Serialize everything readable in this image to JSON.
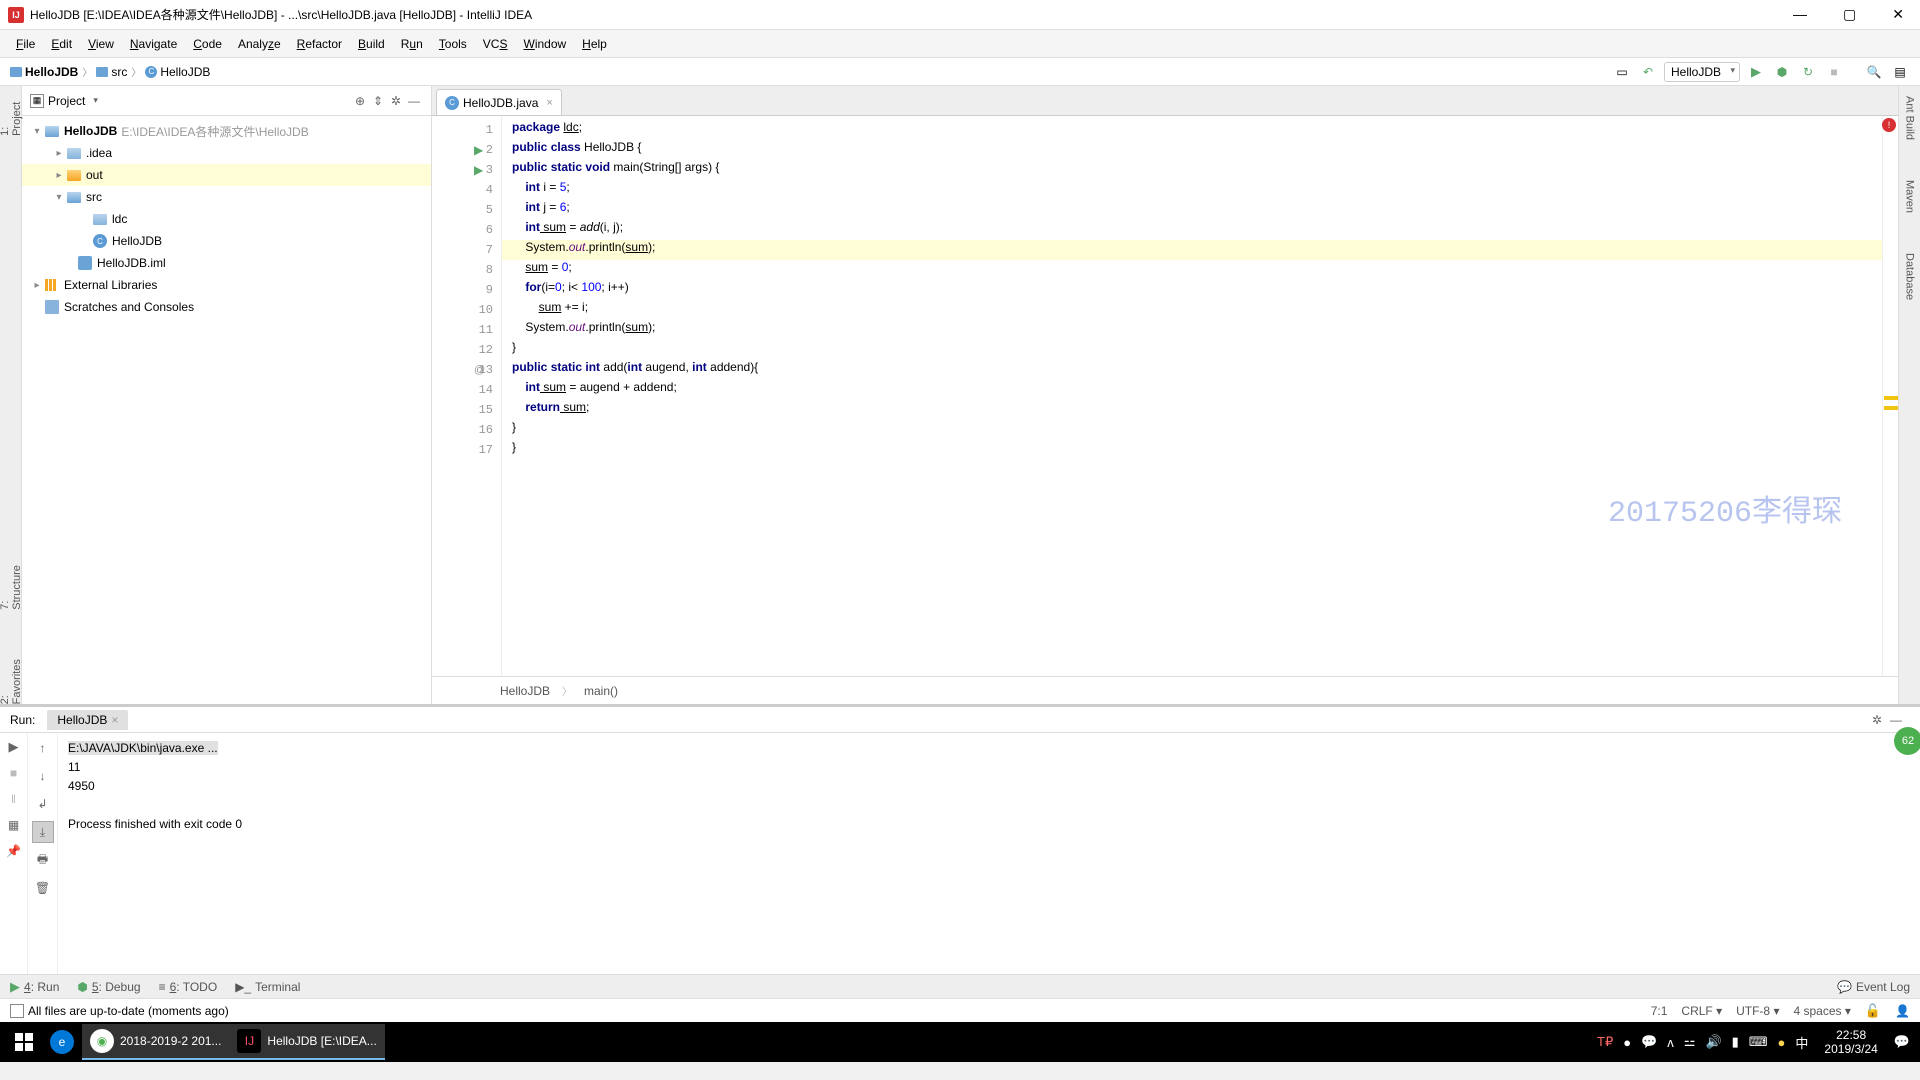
{
  "titlebar": {
    "title": "HelloJDB [E:\\IDEA\\IDEA各种源文件\\HelloJDB] - ...\\src\\HelloJDB.java [HelloJDB] - IntelliJ IDEA"
  },
  "menubar": {
    "items": [
      "File",
      "Edit",
      "View",
      "Navigate",
      "Code",
      "Analyze",
      "Refactor",
      "Build",
      "Run",
      "Tools",
      "VCS",
      "Window",
      "Help"
    ]
  },
  "breadcrumb": {
    "items": [
      "HelloJDB",
      "src",
      "HelloJDB"
    ]
  },
  "toolbar": {
    "run_config": "HelloJDB"
  },
  "project_panel": {
    "title": "Project",
    "root": {
      "name": "HelloJDB",
      "path": "E:\\IDEA\\IDEA各种源文件\\HelloJDB"
    },
    "nodes": {
      "idea": ".idea",
      "out": "out",
      "src": "src",
      "ldc": "ldc",
      "hellojdb_class": "HelloJDB",
      "iml": "HelloJDB.iml",
      "ext_lib": "External Libraries",
      "scratch": "Scratches and Consoles"
    }
  },
  "editor": {
    "tab": "HelloJDB.java",
    "lines": {
      "l1_package": "package",
      "l1_ldc": "ldc",
      "l1_semi": ";",
      "l2_public": "public",
      "l2_class": "class",
      "l2_name": " HelloJDB {",
      "l3_public": "public",
      "l3_static": "static",
      "l3_void": "void",
      "l3_main": " main(String[] args) {",
      "l4_int": "int",
      "l4_rest": " i = ",
      "l4_num": "5",
      "l4_semi": ";",
      "l5_int": "int",
      "l5_rest": " j = ",
      "l5_num": "6",
      "l5_semi": ";",
      "l6_int": "int",
      "l6_sum": " sum",
      "l6_eq": " = ",
      "l6_add": "add",
      "l6_args": "(i, j);",
      "l7_sys": "System.",
      "l7_out": "out",
      "l7_print": ".println(",
      "l7_sum": "sum",
      "l7_end": ");",
      "l8_sum": "sum",
      "l8_eq": " = ",
      "l8_num": "0",
      "l8_semi": ";",
      "l9_for": "for",
      "l9_open": "(i=",
      "l9_z": "0",
      "l9_semi": "; i< ",
      "l9_hund": "100",
      "l9_rest": "; i++)",
      "l10_sum": "sum",
      "l10_rest": " += i;",
      "l11_sys": "System.",
      "l11_out": "out",
      "l11_print": ".println(",
      "l11_sum": "sum",
      "l11_end": ");",
      "l12": "}",
      "l13_public": "public",
      "l13_static": "static",
      "l13_int": "int",
      "l13_add": " add(",
      "l13_int2": "int",
      "l13_aug": " augend, ",
      "l13_int3": "int",
      "l13_addend": " addend){",
      "l14_int": "int",
      "l14_sum": " sum",
      "l14_rest": " = augend + addend;",
      "l15_return": "return",
      "l15_sum": " sum",
      "l15_semi": ";",
      "l16": "}",
      "l17": "}"
    },
    "breadcrumb": {
      "class": "HelloJDB",
      "method": "main()"
    },
    "watermark": "20175206李得琛"
  },
  "left_strip": {
    "project": "1: Project",
    "structure": "7: Structure",
    "favorites": "2: Favorites"
  },
  "right_strip": {
    "ant": "Ant Build",
    "maven": "Maven",
    "database": "Database"
  },
  "run_panel": {
    "label": "Run:",
    "tab": "HelloJDB",
    "output": {
      "cmd": "E:\\JAVA\\JDK\\bin\\java.exe ...",
      "line1": "11",
      "line2": "4950",
      "exit": "Process finished with exit code 0"
    },
    "green_badge": "62"
  },
  "bottom_bar": {
    "run": "4: Run",
    "debug": "5: Debug",
    "todo": "6: TODO",
    "terminal": "Terminal",
    "event_log": "Event Log"
  },
  "status_bar": {
    "msg": "All files are up-to-date (moments ago)",
    "pos": "7:1",
    "crlf": "CRLF",
    "enc": "UTF-8",
    "indent": "4 spaces"
  },
  "taskbar": {
    "items": {
      "chrome": "2018-2019-2 201...",
      "intellij": "HelloJDB [E:\\IDEA..."
    },
    "ime": "中",
    "time": "22:58",
    "date": "2019/3/24"
  }
}
